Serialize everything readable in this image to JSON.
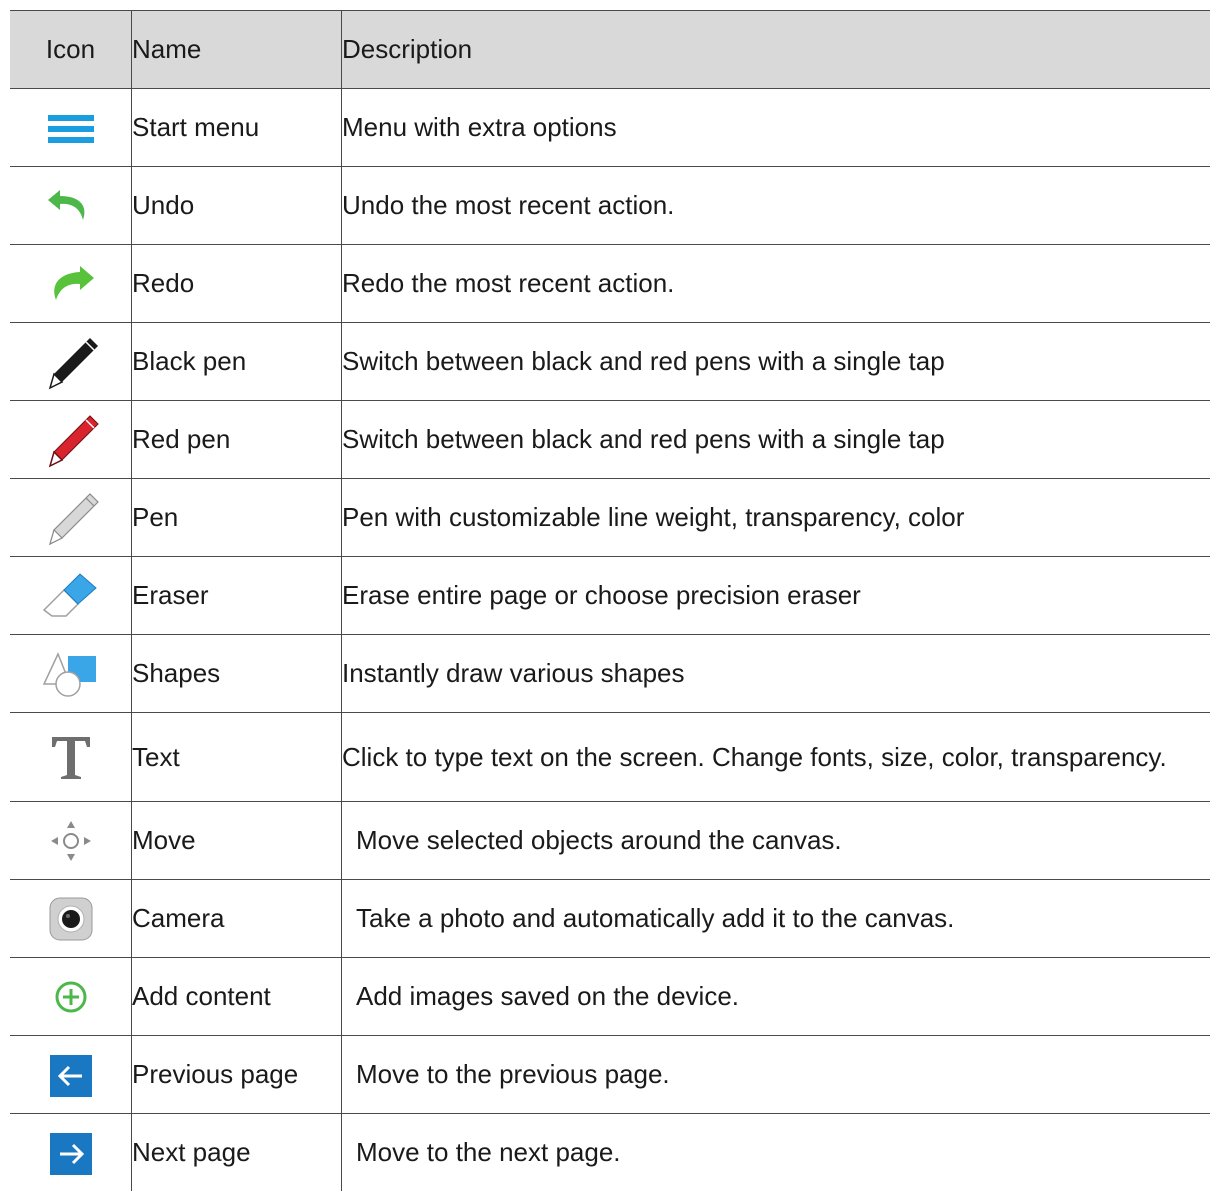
{
  "header": {
    "icon": "Icon",
    "name": "Name",
    "description": "Description"
  },
  "rows": [
    {
      "icon": "hamburger-menu-icon",
      "name": "Start menu",
      "description": "Menu with extra options"
    },
    {
      "icon": "undo-arrow-icon",
      "name": "Undo",
      "description": "Undo the most recent action."
    },
    {
      "icon": "redo-arrow-icon",
      "name": "Redo",
      "description": "Redo the most recent action."
    },
    {
      "icon": "black-pencil-icon",
      "name": "Black pen",
      "description": "Switch between black and red pens with a single tap"
    },
    {
      "icon": "red-pencil-icon",
      "name": "Red pen",
      "description": "Switch between black and red pens with a single tap"
    },
    {
      "icon": "gray-pencil-icon",
      "name": "Pen",
      "description": "Pen with customizable line weight, transparency, color"
    },
    {
      "icon": "eraser-icon",
      "name": "Eraser",
      "description": "Erase entire page or choose precision eraser"
    },
    {
      "icon": "shapes-icon",
      "name": "Shapes",
      "description": "Instantly draw various shapes"
    },
    {
      "icon": "text-t-icon",
      "name": "Text",
      "description": "Click to type text on the screen. Change fonts, size, color, transparency."
    },
    {
      "icon": "move-arrows-icon",
      "name": "Move",
      "description": "Move selected objects around the canvas."
    },
    {
      "icon": "camera-lens-icon",
      "name": "Camera",
      "description": "Take a photo and automatically add it to the canvas."
    },
    {
      "icon": "plus-circle-icon",
      "name": "Add content",
      "description": "Add images saved on the device."
    },
    {
      "icon": "arrow-left-icon",
      "name": "Previous page",
      "description": "Move to the previous page."
    },
    {
      "icon": "arrow-right-icon",
      "name": "Next page",
      "description": "Move to the next page."
    }
  ],
  "colors": {
    "header_bg": "#d9d9d9",
    "menu_blue": "#1a9ee0",
    "green": "#4cb84a",
    "red_pen": "#d9232d",
    "page_button_blue": "#1a78c2"
  }
}
